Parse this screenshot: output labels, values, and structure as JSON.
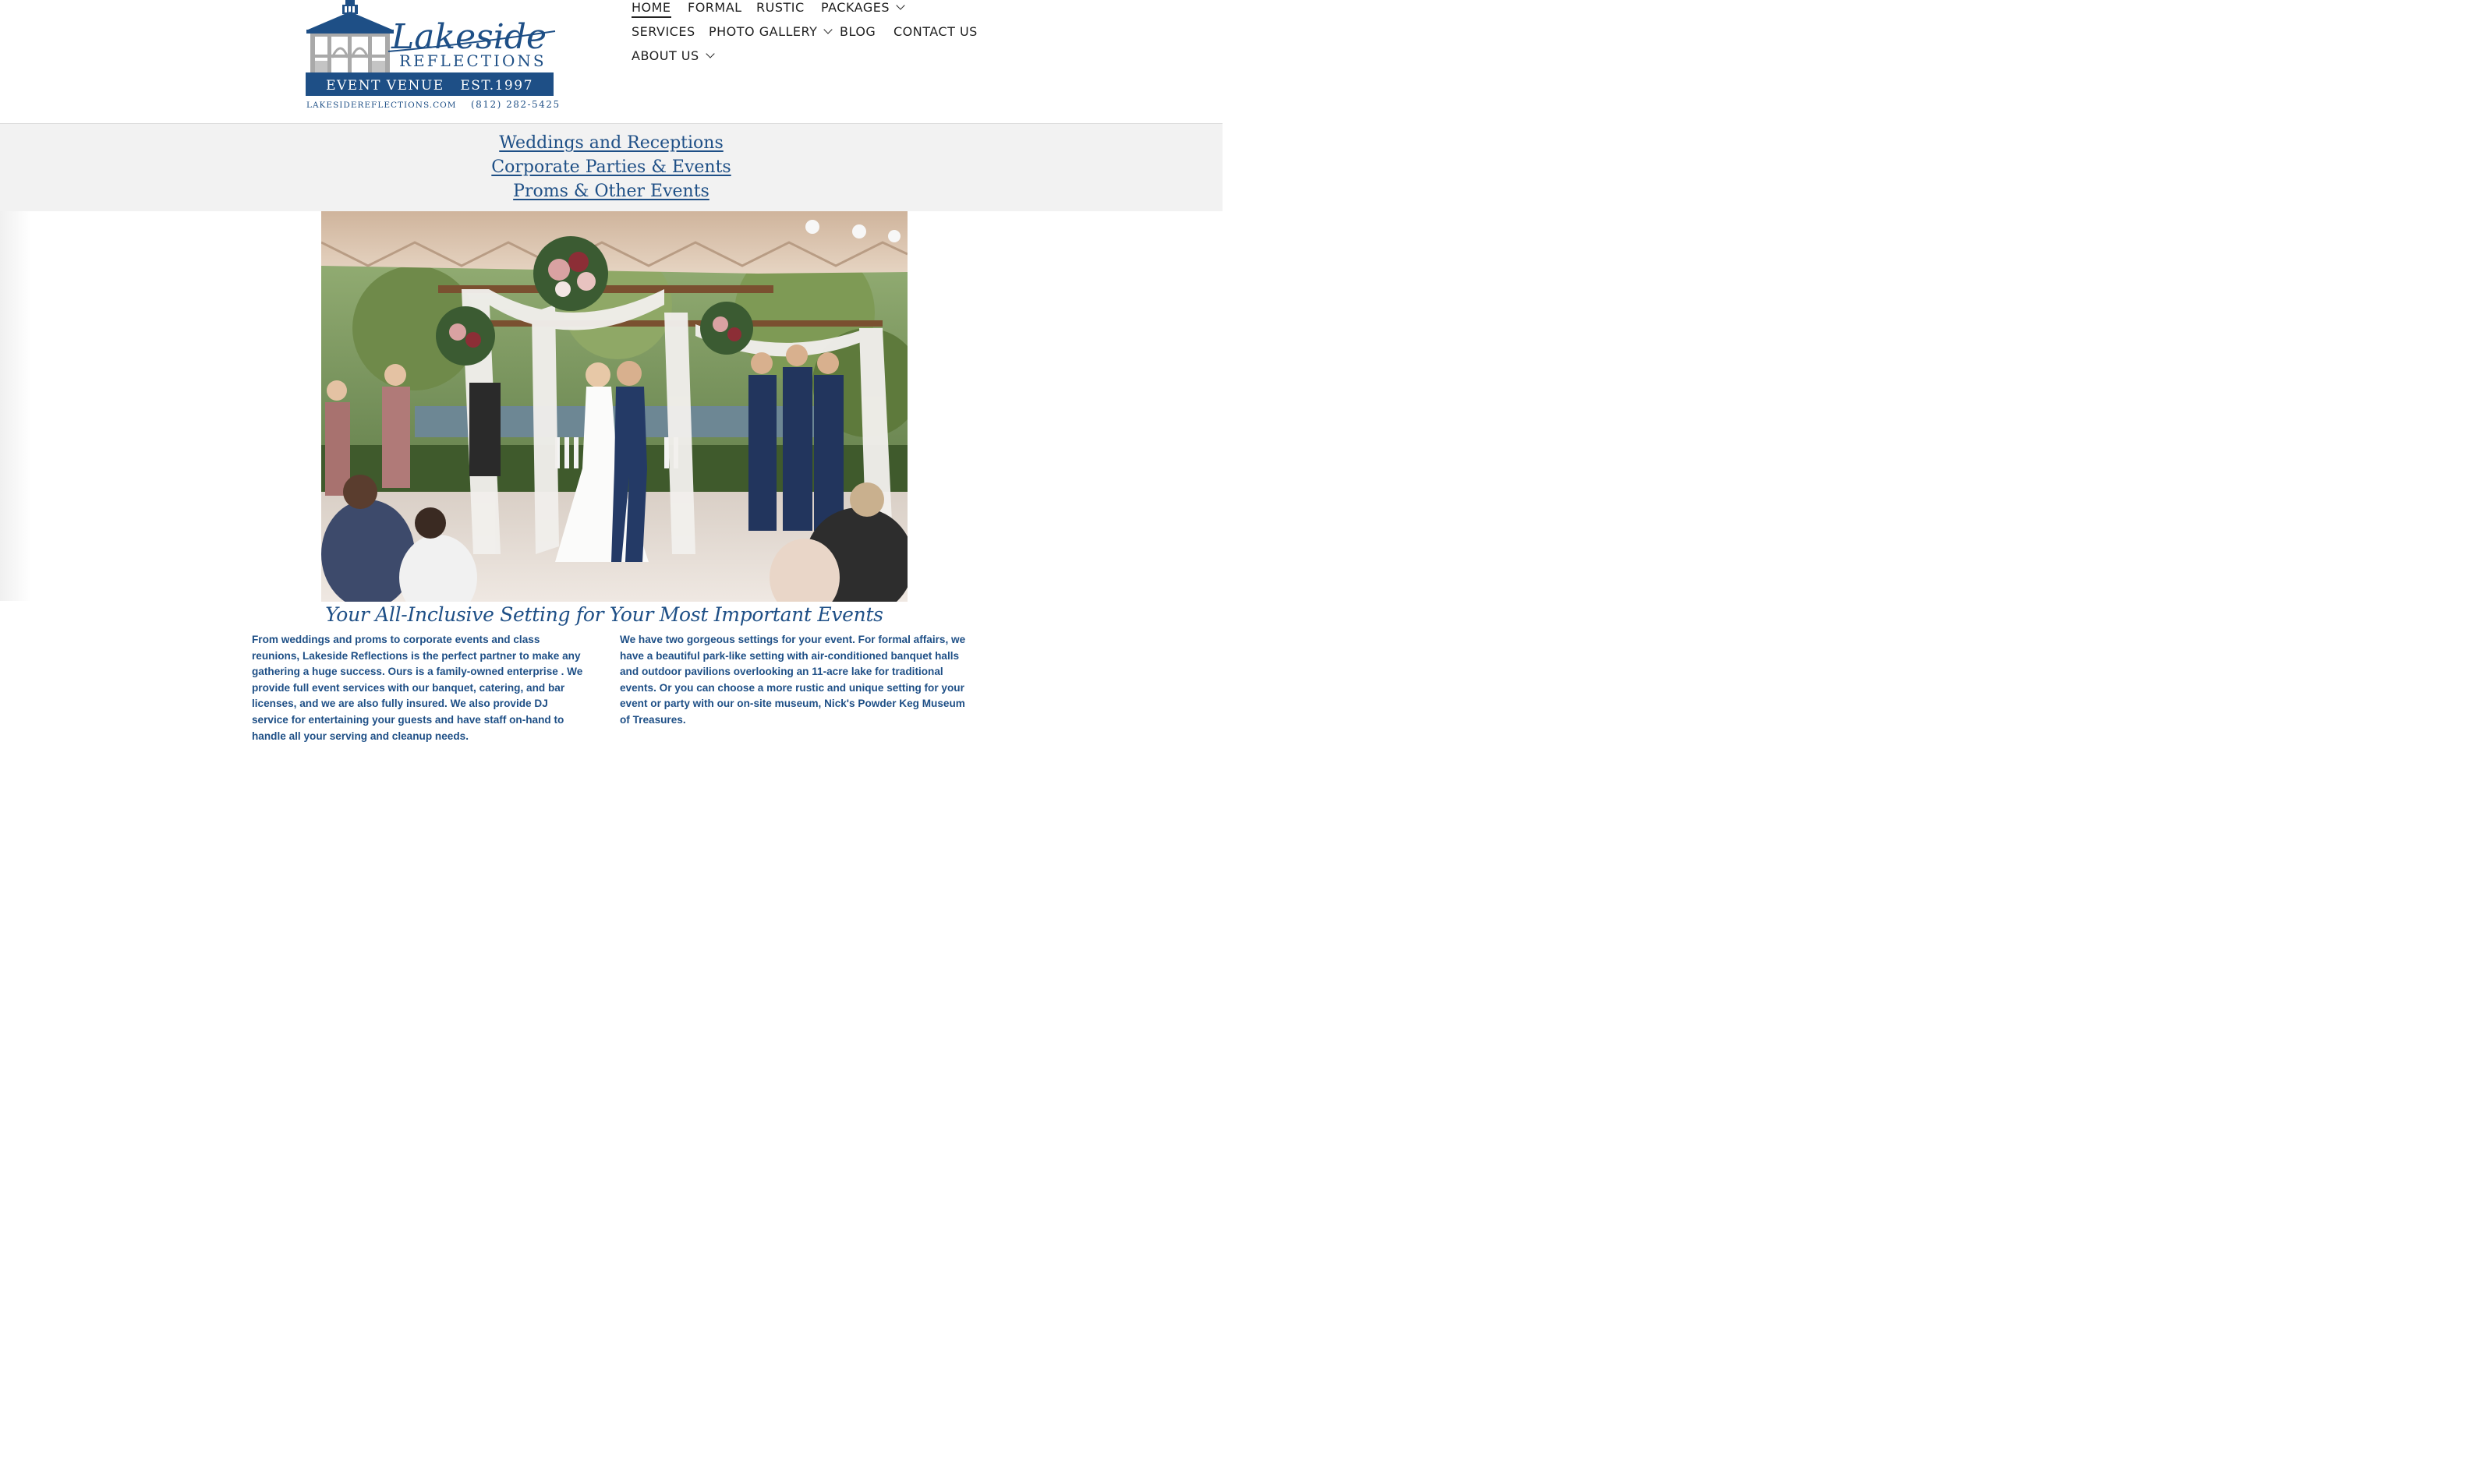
{
  "logo": {
    "name_line1": "Lakeside",
    "name_line2": "REFLECTIONS",
    "venue_line": "EVENT VENUE   EST.1997",
    "website": "LAKESIDEREFLECTIONS.COM",
    "phone": "(812) 282-5425",
    "colors": {
      "navy": "#1e4f86",
      "gray": "#9c9c9c"
    }
  },
  "nav": {
    "items": [
      {
        "label": "HOME",
        "active": true,
        "dropdown": false
      },
      {
        "label": "FORMAL",
        "dropdown": false
      },
      {
        "label": "RUSTIC",
        "dropdown": false
      },
      {
        "label": "PACKAGES",
        "dropdown": true
      },
      {
        "label": "SERVICES",
        "dropdown": false
      },
      {
        "label": "PHOTO GALLERY",
        "dropdown": true
      },
      {
        "label": "BLOG",
        "dropdown": false
      },
      {
        "label": "CONTACT US",
        "dropdown": false
      },
      {
        "label": "ABOUT US",
        "dropdown": true
      }
    ]
  },
  "tagline": {
    "lines": [
      "Weddings and Receptions",
      "Corporate Parties & Events",
      "Proms & Other Events"
    ]
  },
  "hero": {
    "scene": "wedding-ceremony-under-tent"
  },
  "content": {
    "headline": "Your All-Inclusive Setting for Your Most Important Events",
    "left_paragraph": "From weddings and proms to corporate events and class reunions, Lakeside Reflections is the perfect partner to make any gathering a huge success. Ours is a family-owned enterprise . We provide full event services with our banquet, catering, and bar licenses, and we are also fully insured. We also provide DJ service for entertaining your guests and have staff on-hand to handle all your serving and cleanup needs.",
    "right_paragraph": "We have two gorgeous settings for your event. For formal affairs, we have a beautiful park-like setting with air-conditioned banquet halls and outdoor pavilions overlooking an 11-acre lake for traditional events. Or you can choose a more rustic and unique setting for your event or party with our on-site museum, Nick's Powder Keg Museum of Treasures."
  },
  "theme": {
    "accent": "#1e4f86",
    "band_bg": "#f2f2f2"
  }
}
